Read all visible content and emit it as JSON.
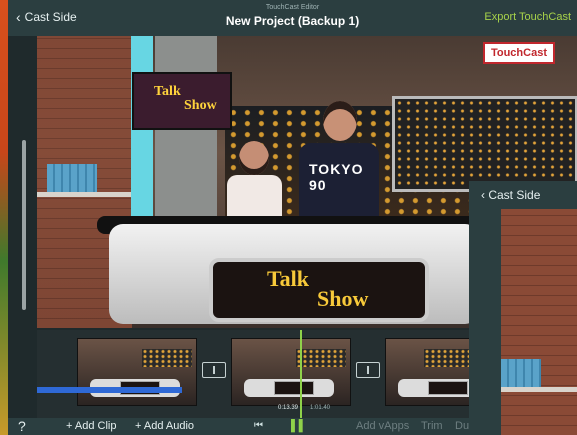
{
  "window": {
    "back_label": "Cast Side",
    "app_subtitle": "TouchCast Editor",
    "title": "New Project (Backup 1)",
    "export_label": "Export TouchCast"
  },
  "preview": {
    "logo_text": "TouchCast",
    "tv_text_1": "Talk",
    "tv_text_2": "Show",
    "desk_text_1": "Talk",
    "desk_text_2": "Show",
    "shirt_text": "TOKYO 90"
  },
  "timeline": {
    "current_time": "0:13.39",
    "end_time": "1:01.40"
  },
  "toolbar": {
    "help": "?",
    "add_clip": "+ Add Clip",
    "add_audio": "+ Add Audio",
    "skip_back": "⏮",
    "pause": "▌▌",
    "add_vapps": "Add vApps",
    "trim": "Trim",
    "dup": "Du"
  },
  "panel": {
    "back_label": "Cast Side"
  },
  "colors": {
    "accent": "#a7d24a",
    "bar": "#2b3e40"
  }
}
